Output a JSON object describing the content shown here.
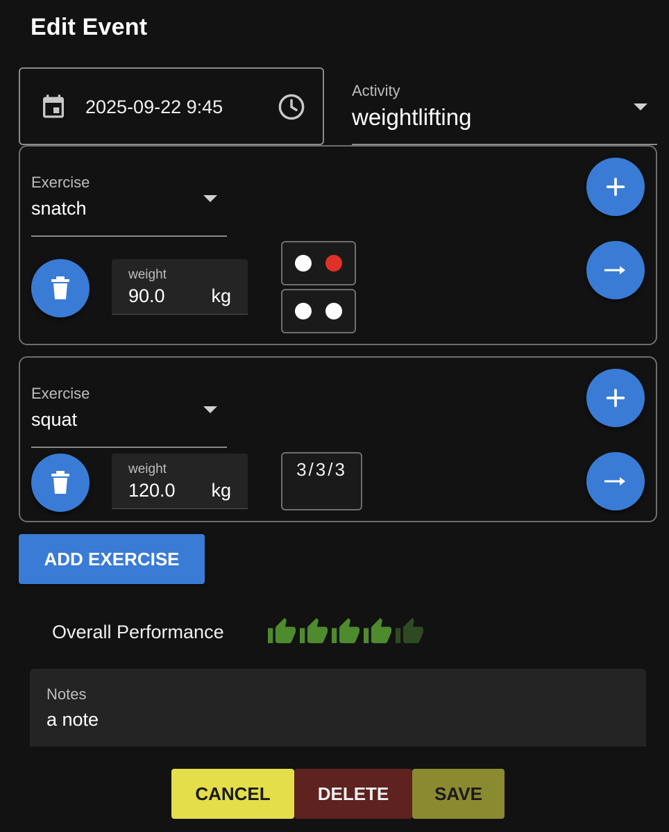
{
  "header": {
    "title": "Edit Event"
  },
  "datetime": {
    "value": "2025-09-22 9:45",
    "icons": [
      "calendar-icon",
      "clock-icon"
    ]
  },
  "activity": {
    "label": "Activity",
    "value": "weightlifting"
  },
  "exercises": [
    {
      "label": "Exercise",
      "value": "snatch",
      "weight_label": "weight",
      "weight": "90.0",
      "unit": "kg",
      "sets": [
        {
          "dots": [
            "white",
            "red"
          ]
        },
        {
          "dots": [
            "white",
            "white"
          ]
        }
      ]
    },
    {
      "label": "Exercise",
      "value": "squat",
      "weight_label": "weight",
      "weight": "120.0",
      "unit": "kg",
      "reps": "3/3/3"
    }
  ],
  "add_exercise_label": "ADD EXERCISE",
  "performance": {
    "label": "Overall Performance",
    "rating": 4,
    "max": 5
  },
  "notes": {
    "label": "Notes",
    "value": "a note"
  },
  "actions": {
    "cancel": "CANCEL",
    "delete": "DELETE",
    "save": "SAVE"
  },
  "colors": {
    "background": "#121212",
    "accent": "#3a7bd5",
    "dot_red": "#e0302a",
    "thumb_active": "#4e8a2e",
    "thumb_inactive": "#2f4a22",
    "cancel": "#e3de4a",
    "delete": "#5e2220",
    "save": "#8a8a30"
  }
}
